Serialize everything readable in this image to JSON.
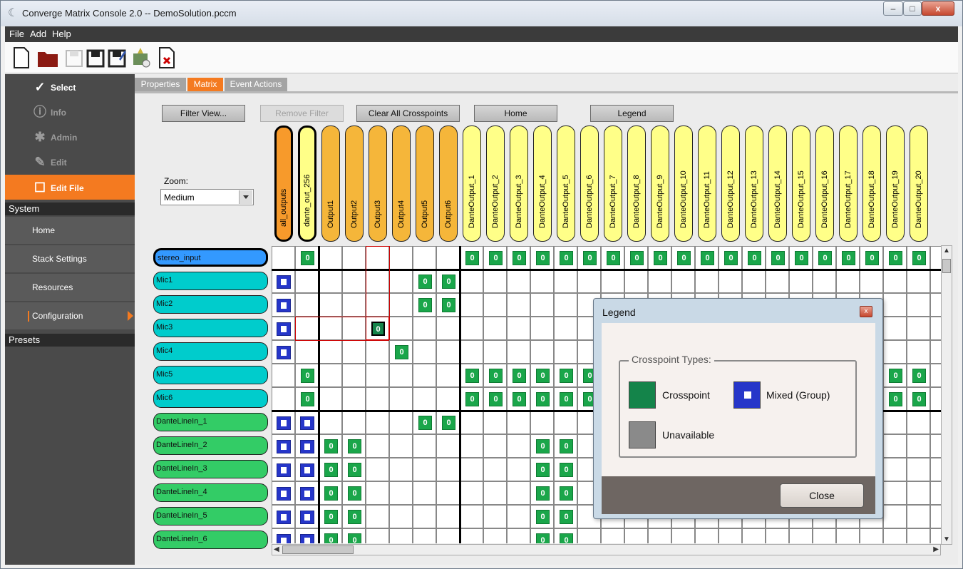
{
  "window": {
    "title": "Converge Matrix Console 2.0 -- DemoSolution.pccm"
  },
  "menu": [
    "File",
    "Add",
    "Help"
  ],
  "nav": {
    "modes": [
      {
        "label": "Select",
        "icon": "checkmark-icon"
      },
      {
        "label": "Info",
        "icon": "info-icon"
      },
      {
        "label": "Admin",
        "icon": "gear-icon"
      },
      {
        "label": "Edit",
        "icon": "wrench-icon"
      },
      {
        "label": "Edit File",
        "icon": "edit-file-icon"
      }
    ],
    "sections": {
      "system": "System",
      "presets": "Presets"
    },
    "items": [
      "Home",
      "Stack Settings",
      "Resources",
      "Configuration"
    ]
  },
  "tabs": [
    "Properties",
    "Matrix",
    "Event Actions"
  ],
  "active_tab": "Matrix",
  "buttons": {
    "filter_view": "Filter View...",
    "remove_filter": "Remove Filter",
    "clear_all": "Clear All Crosspoints",
    "home": "Home",
    "legend": "Legend"
  },
  "zoom": {
    "label": "Zoom:",
    "value": "Medium"
  },
  "outputs": [
    "all_outputs",
    "dante_out_256",
    "Output1",
    "Output2",
    "Output3",
    "Output4",
    "Output5",
    "Output6",
    "DanteOutput_1",
    "DanteOutput_2",
    "DanteOutput_3",
    "DanteOutput_4",
    "DanteOutput_5",
    "DanteOutput_6",
    "DanteOutput_7",
    "DanteOutput_8",
    "DanteOutput_9",
    "DanteOutput_10",
    "DanteOutput_11",
    "DanteOutput_12",
    "DanteOutput_13",
    "DanteOutput_14",
    "DanteOutput_15",
    "DanteOutput_16",
    "DanteOutput_17",
    "DanteOutput_18",
    "DanteOutput_19",
    "DanteOutput_20"
  ],
  "inputs": [
    "stereo_input",
    "Mic1",
    "Mic2",
    "Mic3",
    "Mic4",
    "Mic5",
    "Mic6",
    "DanteLineIn_1",
    "DanteLineIn_2",
    "DanteLineIn_3",
    "DanteLineIn_4",
    "DanteLineIn_5",
    "DanteLineIn_6"
  ],
  "crosspoint_value": "0",
  "legend": {
    "title": "Legend",
    "group_title": "Crosspoint Types:",
    "types": [
      "Crosspoint",
      "Mixed (Group)",
      "Unavailable"
    ],
    "close": "Close"
  },
  "colors": {
    "accent": "#f47a20",
    "crosspoint": "#1aa64a",
    "mixed": "#2636c9",
    "unavailable": "#8a8a8a",
    "input_mic": "#00cccc",
    "input_dante": "#33cc66",
    "input_stereo": "#3399ff",
    "output_group": "#f79a2b",
    "output_analog": "#f5b63a",
    "output_dante": "#ffff88"
  }
}
